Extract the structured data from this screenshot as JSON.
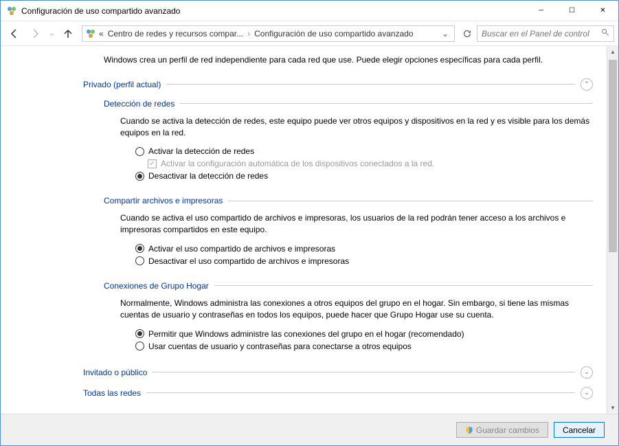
{
  "window": {
    "title": "Configuración de uso compartido avanzado"
  },
  "breadcrumb": {
    "prefix": "«",
    "item1": "Centro de redes y recursos compar...",
    "item2": "Configuración de uso compartido avanzado"
  },
  "search": {
    "placeholder": "Buscar en el Panel de control"
  },
  "intro": "Windows crea un perfil de red independiente para cada red que use. Puede elegir opciones específicas para cada perfil.",
  "profiles": {
    "private": {
      "title": "Privado (perfil actual)",
      "sections": {
        "network_discovery": {
          "title": "Detección de redes",
          "desc": "Cuando se activa la detección de redes, este equipo puede ver otros equipos y dispositivos en la red y es visible para los demás equipos en la red.",
          "opt_on": "Activar la detección de redes",
          "opt_auto": "Activar la configuración automática de los dispositivos conectados a la red.",
          "opt_off": "Desactivar la detección de redes"
        },
        "file_sharing": {
          "title": "Compartir archivos e impresoras",
          "desc": "Cuando se activa el uso compartido de archivos e impresoras, los usuarios de la red podrán tener acceso a los archivos e impresoras compartidos en este equipo.",
          "opt_on": "Activar el uso compartido de archivos e impresoras",
          "opt_off": "Desactivar el uso compartido de archivos e impresoras"
        },
        "homegroup": {
          "title": "Conexiones de Grupo Hogar",
          "desc": "Normalmente, Windows administra las conexiones a otros equipos del grupo en el hogar. Sin embargo, si tiene las mismas cuentas de usuario y contraseñas en todos los equipos, puede hacer que Grupo Hogar use su cuenta.",
          "opt_win": "Permitir que Windows administre las conexiones del grupo en el hogar (recomendado)",
          "opt_user": "Usar cuentas de usuario y contraseñas para conectarse a otros equipos"
        }
      }
    },
    "guest": {
      "title": "Invitado o público"
    },
    "all": {
      "title": "Todas las redes"
    }
  },
  "footer": {
    "save": "Guardar cambios",
    "cancel": "Cancelar"
  }
}
